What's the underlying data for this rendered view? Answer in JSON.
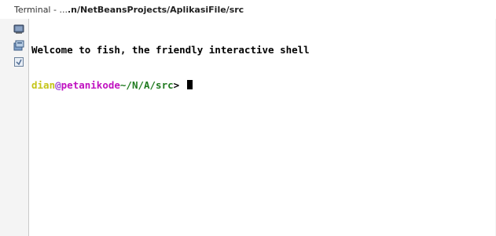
{
  "window": {
    "title_prefix": "Terminal - ...",
    "title_path": ".n/NetBeansProjects/AplikasiFile/src"
  },
  "toolbar": {
    "icons": [
      "terminal-icon",
      "new-tab-icon",
      "clear-icon"
    ]
  },
  "terminal": {
    "welcome": "Welcome to fish, the friendly interactive shell",
    "prompt": {
      "user": "dian",
      "at": "@",
      "host": "petanikode",
      "cwd": "~/N/A/src",
      "symbol": ">"
    },
    "colors": {
      "user": "#c5c518",
      "at": "#9b3fd6",
      "host": "#c012c0",
      "cwd": "#1f7a1f"
    }
  }
}
